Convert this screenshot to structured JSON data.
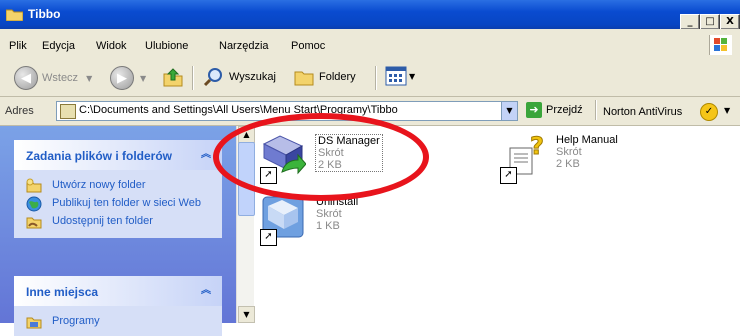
{
  "window": {
    "title": "Tibbo",
    "controls": [
      "_",
      "□",
      "X"
    ]
  },
  "menu": [
    "Plik",
    "Edycja",
    "Widok",
    "Ulubione",
    "Narzędzia",
    "Pomoc"
  ],
  "toolbar": {
    "back": "Wstecz",
    "search": "Wyszukaj",
    "folders": "Foldery"
  },
  "address": {
    "label": "Adres",
    "value": "C:\\Documents and Settings\\All Users\\Menu Start\\Programy\\Tibbo",
    "go": "Przejdź",
    "norton": "Norton AntiVirus"
  },
  "tasks": {
    "title": "Zadania plików i folderów",
    "items": [
      "Utwórz nowy folder",
      "Publikuj ten folder w sieci Web",
      "Udostępnij ten folder"
    ]
  },
  "places": {
    "title": "Inne miejsca",
    "items": [
      "Programy"
    ]
  },
  "files": [
    {
      "name": "DS Manager",
      "type": "Skrót",
      "size": "2 KB"
    },
    {
      "name": "Help Manual",
      "type": "Skrót",
      "size": "2 KB"
    },
    {
      "name": "Uninstall",
      "type": "Skrót",
      "size": "1 KB"
    }
  ],
  "colors": {
    "title_bar": "#0a4bd0",
    "task_link": "#215dc6",
    "annotation": "#e8141c"
  }
}
